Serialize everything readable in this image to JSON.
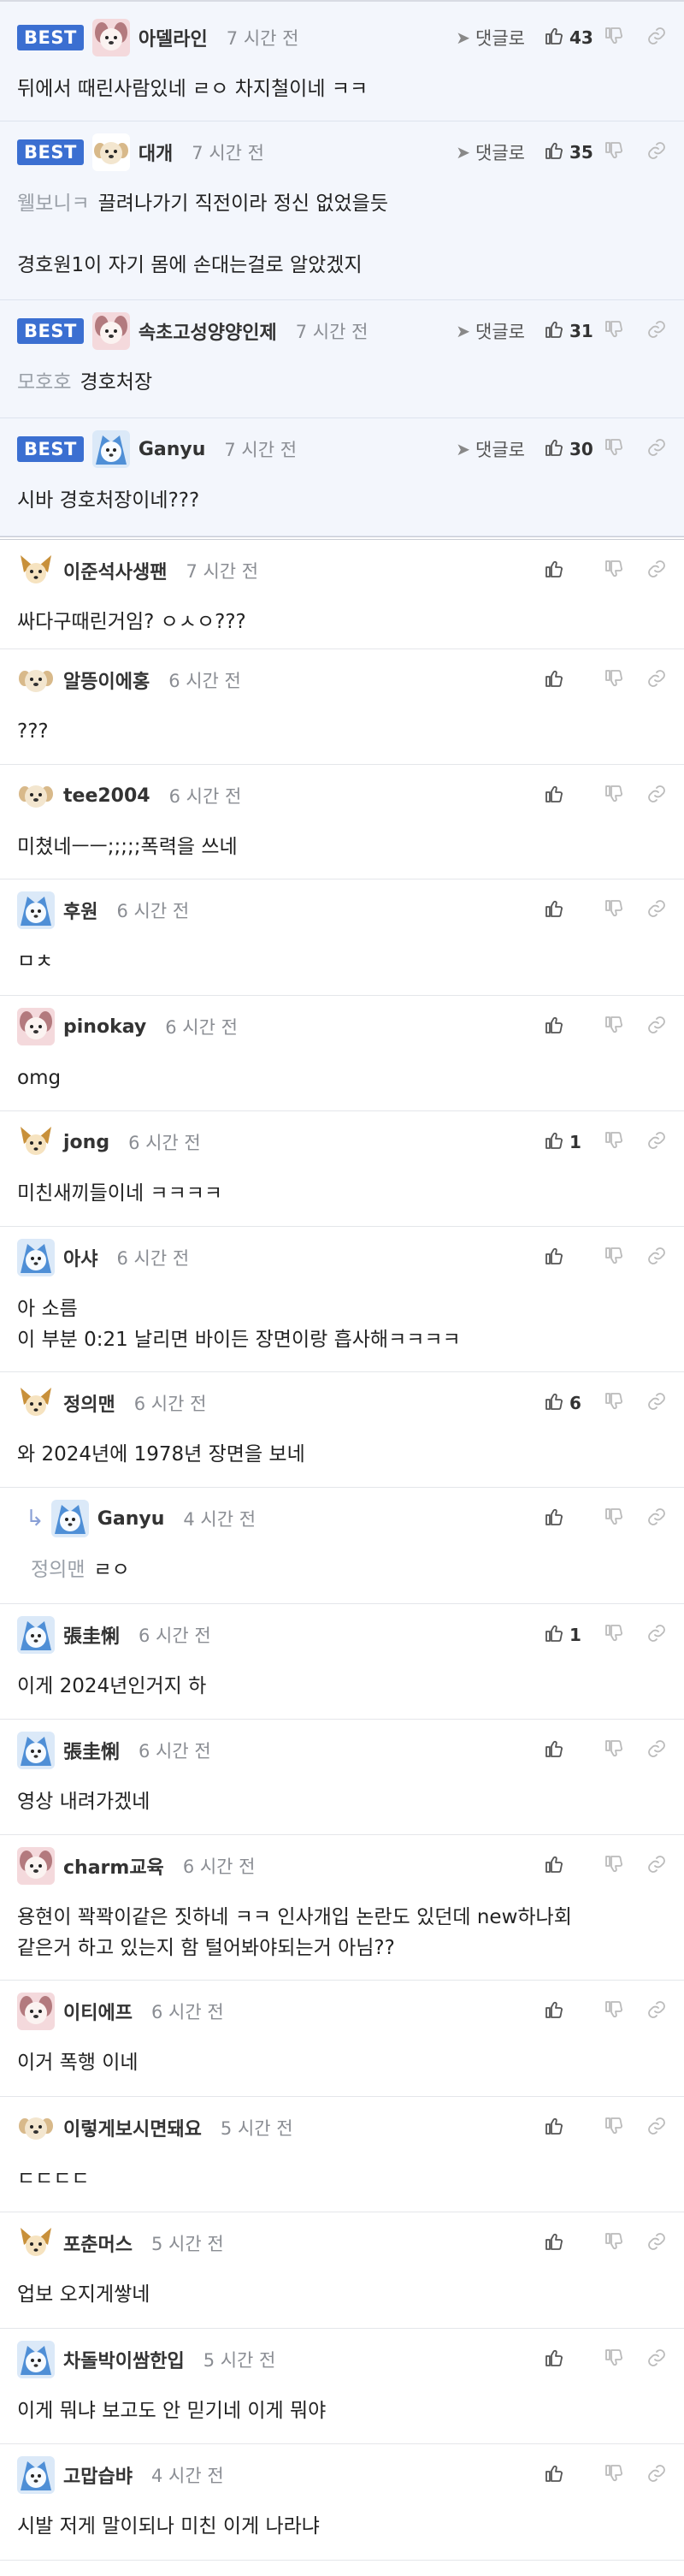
{
  "best_label": "BEST",
  "reply_label": "댓글로",
  "comments": [
    {
      "nick": "아델라인",
      "time": "7 시간 전",
      "best": true,
      "likes": "43",
      "mention": "",
      "lines": [
        "뒤에서 때린사람있네 ㄹㅇ 차지철이네 ㅋㅋ"
      ],
      "avatar": "pink"
    },
    {
      "nick": "대개",
      "time": "7 시간 전",
      "best": true,
      "likes": "35",
      "mention": "웰보니ㅋ",
      "lines": [
        "끌려나가기 직전이라 정신 없었을듯",
        "",
        "경호원1이 자기 몸에 손대는걸로 알았겠지"
      ],
      "avatar": "beige"
    },
    {
      "nick": "속초고성양양인제",
      "time": "7 시간 전",
      "best": true,
      "likes": "31",
      "mention": "모호호",
      "lines": [
        "경호처장"
      ],
      "avatar": "pink"
    },
    {
      "nick": "Ganyu",
      "time": "7 시간 전",
      "best": true,
      "likes": "30",
      "mention": "",
      "lines": [
        "시바 경호처장이네???"
      ],
      "avatar": "blue"
    },
    {
      "nick": "이준석사생팬",
      "time": "7 시간 전",
      "likes": "",
      "mention": "",
      "lines": [
        "싸다구때린거임? ㅇㅅㅇ???"
      ],
      "avatar": "fox"
    },
    {
      "nick": "알뜽이에홍",
      "time": "6 시간 전",
      "likes": "",
      "mention": "",
      "lines": [
        "???"
      ],
      "avatar": "beige"
    },
    {
      "nick": "tee2004",
      "time": "6 시간 전",
      "likes": "",
      "mention": "",
      "lines": [
        "미쳤네ㅡㅡ;;;;;폭력을 쓰네"
      ],
      "avatar": "beige"
    },
    {
      "nick": "후원",
      "time": "6 시간 전",
      "likes": "",
      "mention": "",
      "lines": [
        "ㅁㅊ"
      ],
      "avatar": "blue"
    },
    {
      "nick": "pinokay",
      "time": "6 시간 전",
      "likes": "",
      "mention": "",
      "lines": [
        "omg"
      ],
      "avatar": "pink"
    },
    {
      "nick": "jong",
      "time": "6 시간 전",
      "likes": "1",
      "mention": "",
      "lines": [
        "미친새끼들이네 ㅋㅋㅋㅋ"
      ],
      "avatar": "fox"
    },
    {
      "nick": "아샤",
      "time": "6 시간 전",
      "likes": "",
      "mention": "",
      "lines": [
        "아 소름",
        "이 부분 0:21 날리면 바이든 장면이랑 흡사해ㅋㅋㅋㅋ"
      ],
      "avatar": "blue"
    },
    {
      "nick": "정의맨",
      "time": "6 시간 전",
      "likes": "6",
      "mention": "",
      "lines": [
        "와 2024년에 1978년 장면을 보네"
      ],
      "avatar": "fox"
    },
    {
      "nick": "Ganyu",
      "time": "4 시간 전",
      "likes": "",
      "reply": true,
      "mention": "정의맨",
      "lines": [
        "ㄹㅇ"
      ],
      "avatar": "blue"
    },
    {
      "nick": "張圭悧",
      "time": "6 시간 전",
      "likes": "1",
      "mention": "",
      "lines": [
        "이게 2024년인거지 하"
      ],
      "avatar": "blue"
    },
    {
      "nick": "張圭悧",
      "time": "6 시간 전",
      "likes": "",
      "mention": "",
      "lines": [
        "영상 내려가겠네"
      ],
      "avatar": "blue"
    },
    {
      "nick": "charm교육",
      "time": "6 시간 전",
      "likes": "",
      "mention": "",
      "lines": [
        "용현이 꽉꽉이같은 짓하네 ㅋㅋ 인사개입 논란도 있던데 new하나회",
        "같은거 하고 있는지 함 털어봐야되는거 아님??"
      ],
      "avatar": "pink"
    },
    {
      "nick": "이티에프",
      "time": "6 시간 전",
      "likes": "",
      "mention": "",
      "lines": [
        "이거 폭행 이네"
      ],
      "avatar": "pink"
    },
    {
      "nick": "이렇게보시면돼요",
      "time": "5 시간 전",
      "likes": "",
      "mention": "",
      "lines": [
        "ㄷㄷㄷㄷ"
      ],
      "avatar": "beige"
    },
    {
      "nick": "포춘머스",
      "time": "5 시간 전",
      "likes": "",
      "mention": "",
      "lines": [
        "업보 오지게쌓네"
      ],
      "avatar": "fox"
    },
    {
      "nick": "차돌박이쌈한입",
      "time": "5 시간 전",
      "likes": "",
      "mention": "",
      "lines": [
        "이게 뭐냐 보고도 안 믿기네 이게 뭐야"
      ],
      "avatar": "blue"
    },
    {
      "nick": "고맙습뱌",
      "time": "4 시간 전",
      "likes": "",
      "mention": "",
      "lines": [
        "시발 저게 말이되나 미친 이게 나라냐"
      ],
      "avatar": "blue"
    }
  ],
  "colors": {
    "accent": "#3b6fd1",
    "best_bg": "#f3f6fc",
    "icon": "#666666"
  }
}
